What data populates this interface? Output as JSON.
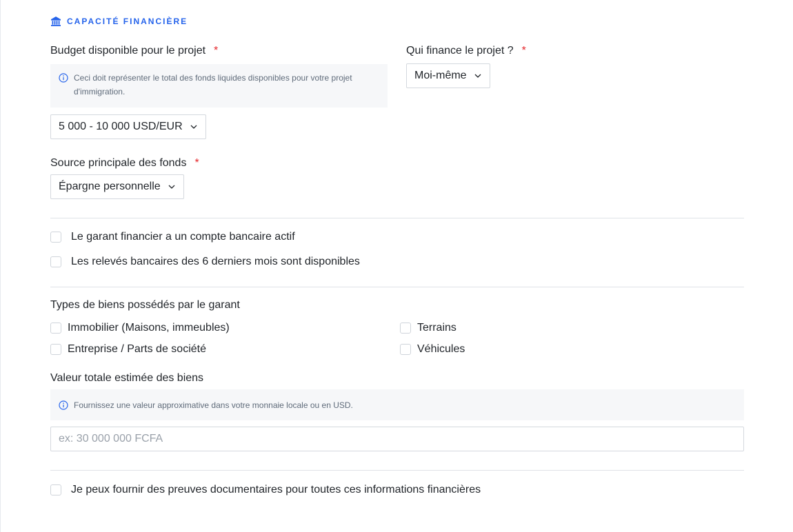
{
  "section": {
    "title": "CAPACITÉ FINANCIÈRE",
    "icon": "bank-icon",
    "accent": "#2563eb"
  },
  "budget": {
    "label": "Budget disponible pour le projet",
    "required": "*",
    "hint_line1": "Ceci doit représenter le total des fonds liquides disponibles pour votre projet",
    "hint_line2": "d'immigration.",
    "value": "5 000 - 10 000 USD/EUR"
  },
  "financer": {
    "label": "Qui finance le projet ?",
    "required": "*",
    "value": "Moi-même"
  },
  "source": {
    "label": "Source principale des fonds",
    "required": "*",
    "value": "Épargne personnelle"
  },
  "bank_checks": [
    {
      "label": "Le garant financier a un compte bancaire actif",
      "checked": false
    },
    {
      "label": "Les relevés bancaires des 6 derniers mois sont disponibles",
      "checked": false
    }
  ],
  "assets": {
    "label": "Types de biens possédés par le garant",
    "options": [
      {
        "label": "Immobilier (Maisons, immeubles)",
        "checked": false
      },
      {
        "label": "Terrains",
        "checked": false
      },
      {
        "label": "Entreprise / Parts de société",
        "checked": false
      },
      {
        "label": "Véhicules",
        "checked": false
      }
    ]
  },
  "value_field": {
    "label": "Valeur totale estimée des biens",
    "hint": "Fournissez une valeur approximative dans votre monnaie locale ou en USD.",
    "placeholder": "ex: 30 000 000 FCFA",
    "value": ""
  },
  "proof": {
    "label": "Je peux fournir des preuves documentaires pour toutes ces informations financières",
    "checked": false
  },
  "colors": {
    "required": "#e5252a",
    "info": "#2563eb",
    "hint_bg": "#f6f7f9",
    "border": "#d4d8de"
  }
}
